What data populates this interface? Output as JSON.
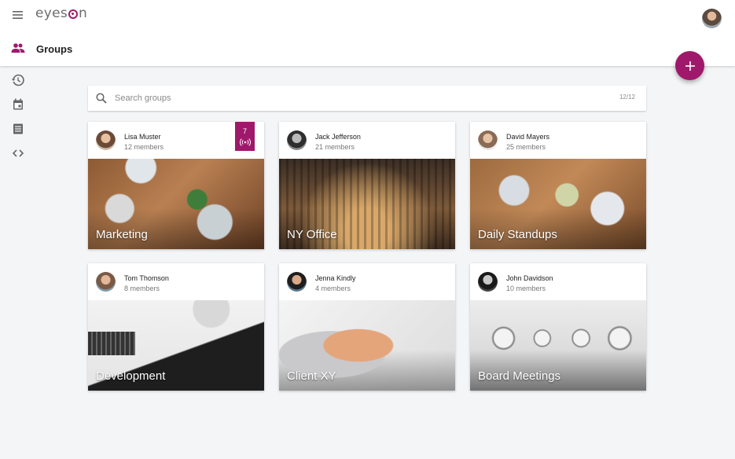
{
  "app": {
    "logo_text_pre": "eyes",
    "logo_text_post": "n"
  },
  "header": {
    "page_title": "Groups"
  },
  "nav": {
    "icons": [
      "menu-icon",
      "group-icon",
      "history-icon",
      "calendar-icon",
      "list-icon",
      "code-icon"
    ]
  },
  "search": {
    "placeholder": "Search groups",
    "value": "",
    "count": "12/12"
  },
  "fab": {
    "icon": "plus-icon"
  },
  "colors": {
    "accent": "#a0186b",
    "background": "#f4f5f7"
  },
  "groups": [
    {
      "owner": "Lisa Muster",
      "members": "12 members",
      "title": "Marketing",
      "live_count": "7"
    },
    {
      "owner": "Jack Jefferson",
      "members": "21 members",
      "title": "NY Office"
    },
    {
      "owner": "David Mayers",
      "members": "25 members",
      "title": "Daily Standups"
    },
    {
      "owner": "Tom Thomson",
      "members": "8 members",
      "title": "Development"
    },
    {
      "owner": "Jenna Kindly",
      "members": "4 members",
      "title": "Client XY"
    },
    {
      "owner": "John Davidson",
      "members": "10 members",
      "title": "Board Meetings"
    }
  ]
}
